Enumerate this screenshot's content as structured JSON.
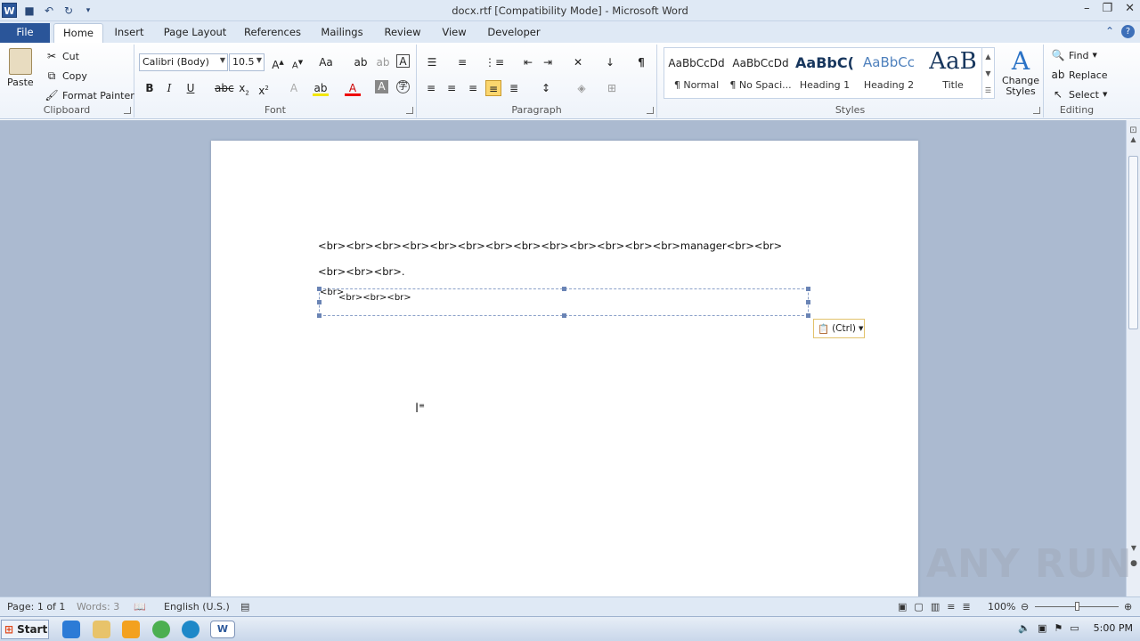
{
  "window": {
    "title": "docx.rtf [Compatibility Mode]  -  Microsoft Word",
    "app_letter": "W"
  },
  "tabs": [
    "File",
    "Home",
    "Insert",
    "Page Layout",
    "References",
    "Mailings",
    "Review",
    "View",
    "Developer"
  ],
  "clipboard": {
    "paste": "Paste",
    "cut": "Cut",
    "copy": "Copy",
    "format_painter": "Format Painter",
    "label": "Clipboard"
  },
  "font": {
    "name": "Calibri (Body)",
    "size": "10.5",
    "label": "Font"
  },
  "paragraph": {
    "label": "Paragraph"
  },
  "styles": {
    "items": [
      {
        "preview": "AaBbCcDd",
        "name": "¶ Normal"
      },
      {
        "preview": "AaBbCcDd",
        "name": "¶ No Spaci..."
      },
      {
        "preview": "AaBbC(",
        "name": "Heading 1"
      },
      {
        "preview": "AaBbCc",
        "name": "Heading 2"
      },
      {
        "preview": "AaB",
        "name": "Title"
      }
    ],
    "change_styles": "Change Styles",
    "label": "Styles"
  },
  "editing": {
    "find": "Find",
    "replace": "Replace",
    "select": "Select",
    "label": "Editing"
  },
  "document": {
    "line1": "<br><br><br><br><br><br><br><br><br><br><br><br><br>manager<br><br>",
    "line2": "<br><br><br>.",
    "textbox_a": "<br>",
    "textbox_b": "<br><br><br>",
    "paste_options": "(Ctrl)"
  },
  "status": {
    "page": "Page: 1 of 1",
    "words": "Words: 3",
    "language": "English (U.S.)",
    "zoom": "100%"
  },
  "taskbar": {
    "start": "Start",
    "time": "5:00 PM"
  },
  "watermark": "ANY RUN",
  "colors": {
    "accent": "#2b579a",
    "file_tab": "#2a5599",
    "workspace": "#abbad0"
  }
}
